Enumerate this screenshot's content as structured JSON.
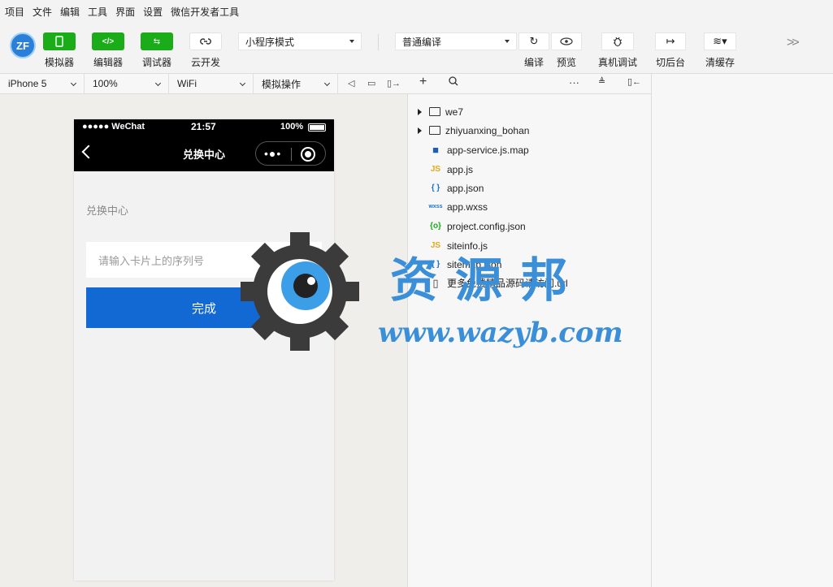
{
  "menubar": [
    "项目",
    "文件",
    "编辑",
    "工具",
    "界面",
    "设置",
    "微信开发者工具"
  ],
  "toolbar": {
    "logo": "ZF",
    "simulator_label": "模拟器",
    "editor_label": "编辑器",
    "debugger_label": "调试器",
    "cloud_label": "云开发",
    "mode_select": "小程序模式",
    "compile_select": "普通编译",
    "compile_label": "编译",
    "preview_label": "预览",
    "remote_debug_label": "真机调试",
    "background_label": "切后台",
    "clear_cache_label": "清缓存"
  },
  "device_bar": {
    "device": "iPhone 5",
    "zoom": "100%",
    "network": "WiFi",
    "action": "模拟操作"
  },
  "phone": {
    "status_left": "●●●●● WeChat",
    "status_time": "21:57",
    "status_battery": "100%",
    "nav_title": "兑换中心",
    "capsule_dots": "•●•",
    "page_label": "兑换中心",
    "input_placeholder": "请输入卡片上的序列号",
    "done_button": "完成"
  },
  "file_tree": [
    {
      "name": "we7",
      "type": "folder"
    },
    {
      "name": "zhiyuanxing_bohan",
      "type": "folder"
    },
    {
      "name": "app-service.js.map",
      "type": "map",
      "icon": "■",
      "color": "#1e5fb3"
    },
    {
      "name": "app.js",
      "type": "js",
      "icon": "JS",
      "color": "#e6a817"
    },
    {
      "name": "app.json",
      "type": "json",
      "icon": "{ }",
      "color": "#1a73c9"
    },
    {
      "name": "app.wxss",
      "type": "wxss",
      "icon": "wxss",
      "color": "#1a73c9"
    },
    {
      "name": "project.config.json",
      "type": "config",
      "icon": "{o}",
      "color": "#1aad19"
    },
    {
      "name": "siteinfo.js",
      "type": "js",
      "icon": "JS",
      "color": "#e6a817"
    },
    {
      "name": "sitemap.json",
      "type": "json",
      "icon": "{ }",
      "color": "#1a73c9"
    },
    {
      "name": "更多免费精品源码请访问.url",
      "type": "file",
      "icon": "▯",
      "color": "#333"
    }
  ],
  "watermark": {
    "title": "资源邦",
    "url": "www.wazyb.com"
  }
}
